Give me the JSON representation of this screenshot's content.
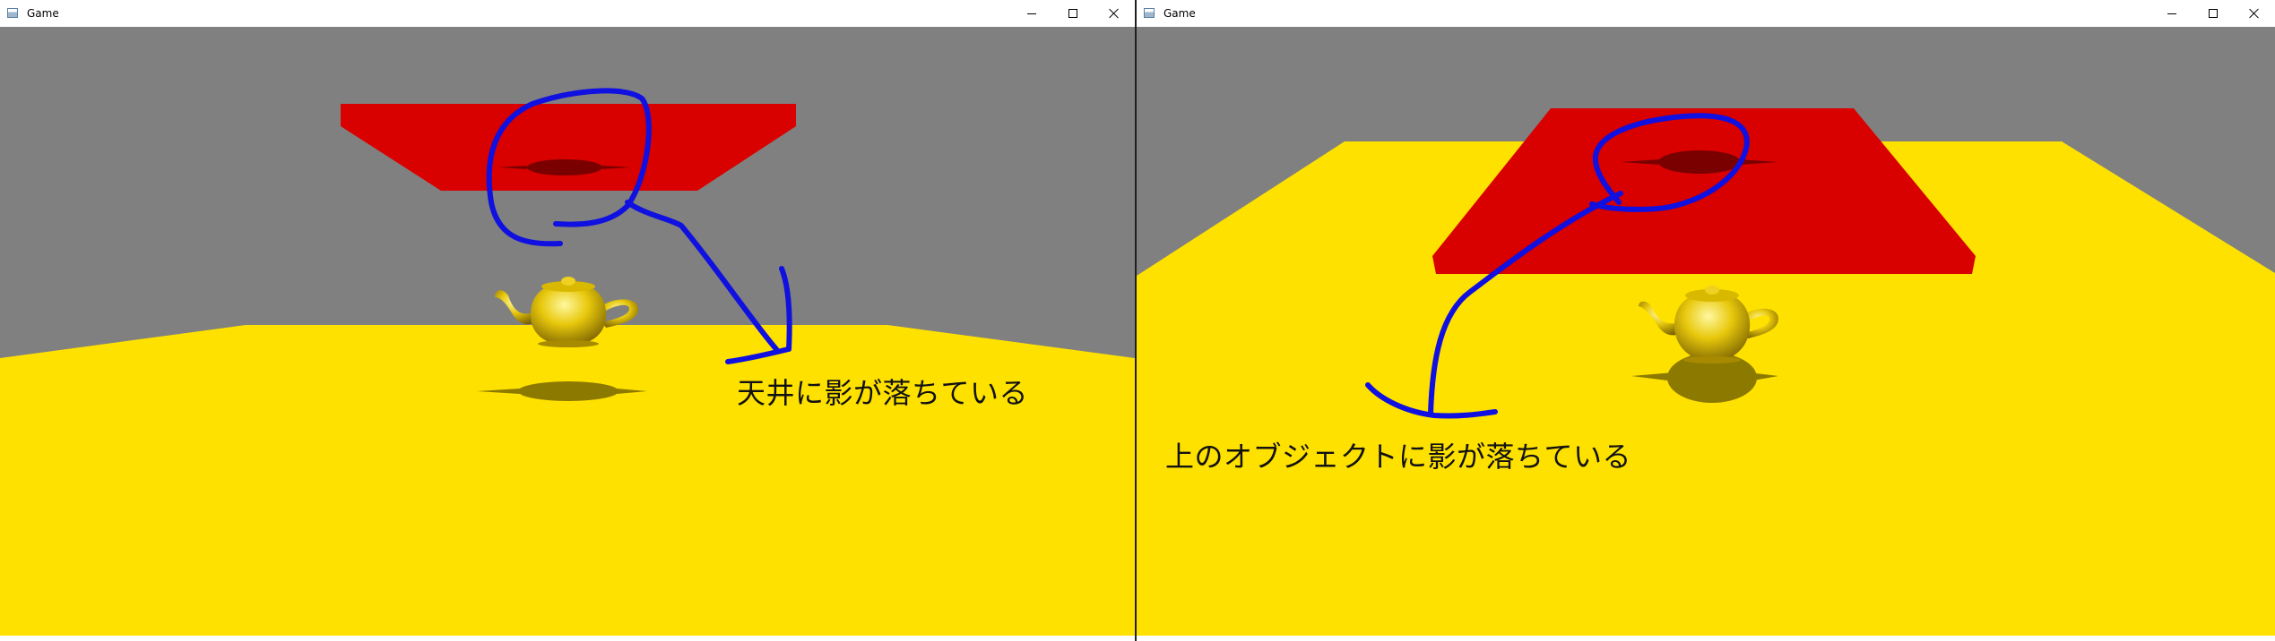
{
  "windows": [
    {
      "title": "Game",
      "caption": "天井に影が落ちている"
    },
    {
      "title": "Game",
      "caption": "上のオブジェクトに影が落ちている"
    }
  ],
  "colors": {
    "sky": "#808080",
    "floor": "#ffe100",
    "ceiling_object": "#d90000",
    "shadow_on_red": "#7a0000",
    "shadow_on_floor": "#8c7a00",
    "teapot": "#e0c010",
    "annotation_stroke": "#1010e0"
  },
  "icons": [
    "window-app-icon",
    "minimize-icon",
    "maximize-icon",
    "close-icon"
  ]
}
